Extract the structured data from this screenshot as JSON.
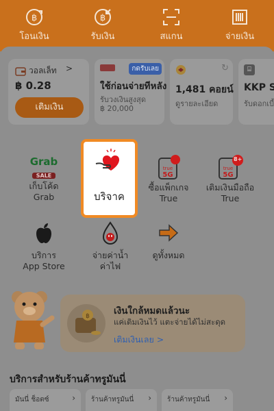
{
  "quick_actions": [
    {
      "label": "โอนเงิน",
      "icon": "transfer-icon"
    },
    {
      "label": "รับเงิน",
      "icon": "receive-money-icon"
    },
    {
      "label": "สแกน",
      "icon": "scan-icon"
    },
    {
      "label": "จ่ายเงิน",
      "icon": "barcode-pay-icon"
    }
  ],
  "wallet": {
    "title": "วอลเล็ท",
    "chevron": ">",
    "balance": "฿ 0.28",
    "topup_label": "เติมเงิน"
  },
  "paylater": {
    "badge": "กดรับเลย",
    "title": "ใช้ก่อนจ่ายทีหลัง",
    "sub1": "รับวงเงินสูงสุด",
    "sub2": "฿ 20,000"
  },
  "coins": {
    "title": "1,481 คอยน์",
    "sub": "ดูรายละเอียด"
  },
  "kkp": {
    "title": "KKP Sta",
    "sub": "รับดอกเบี้"
  },
  "services": {
    "grab": {
      "logo": "Grab",
      "tag": "SALE",
      "label1": "เก็บโค้ด",
      "label2": "Grab"
    },
    "donate": {
      "label": "บริจาค"
    },
    "true5g_pack": {
      "label1": "ซื้อแพ็กเกจ",
      "label2": "True"
    },
    "true5g_topup": {
      "badge": "8+",
      "label1": "เติมเงินมือถือ",
      "label2": "True"
    },
    "appstore": {
      "label1": "บริการ",
      "label2": "App Store"
    },
    "utilities": {
      "label1": "จ่ายค่าน้ำ",
      "label2": "ค่าไฟ"
    },
    "view_all": {
      "label": "ดูทั้งหมด"
    }
  },
  "banner": {
    "title": "เงินใกล้หมดแล้วนะ",
    "sub": "แค่เติมเงินไว้ แตะจ่ายได้ไม่สะดุด",
    "link": "เติมเงินเลย >"
  },
  "section": {
    "title": "บริการสำหรับร้านค้าทรูมันนี่"
  },
  "shops": [
    {
      "label": "มันนี่ ช็อตซ์"
    },
    {
      "label": "ร้านค้าทรูมันนี่"
    },
    {
      "label": "ร้านค้าทรูมันนี่"
    }
  ],
  "colors": {
    "accent": "#f08a24",
    "brand": "#c9701c",
    "link": "#2f5fb0"
  }
}
